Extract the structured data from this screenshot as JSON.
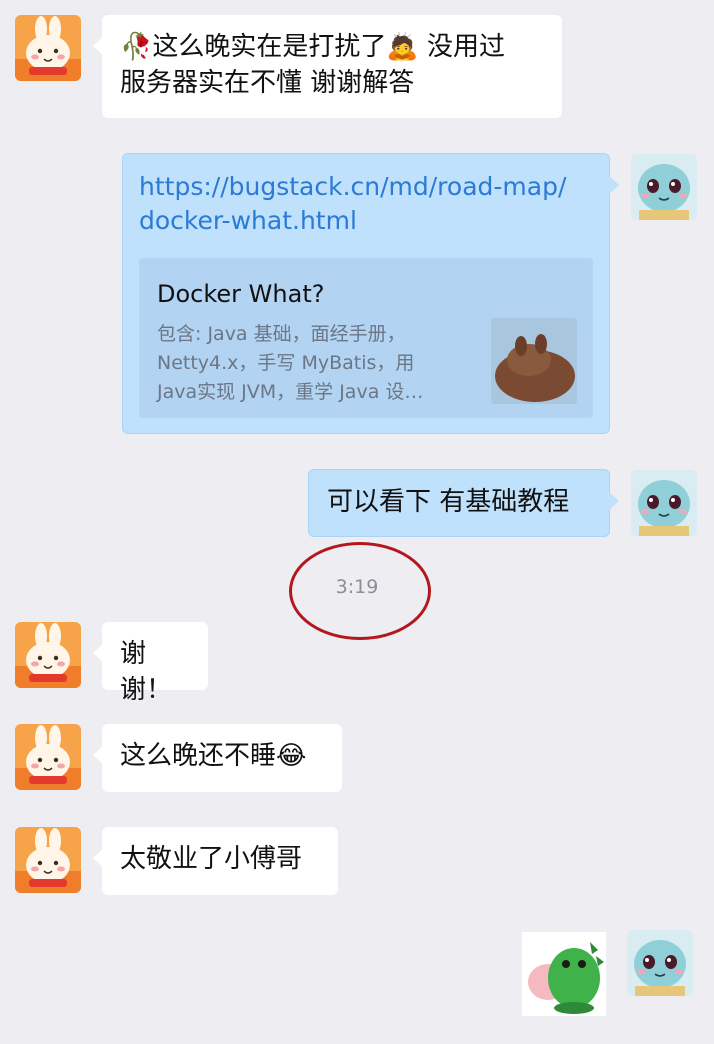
{
  "messages": {
    "m1": {
      "line1": "🥀这么晚实在是打扰了🙇 没用过",
      "line2": "服务器实在不懂 谢谢解答"
    },
    "m2": {
      "link_line1": "https://bugstack.cn/md/road-map/",
      "link_line2": "docker-what.html",
      "card_title": "Docker What?",
      "card_desc_line1": "包含: Java 基础，面经手册，",
      "card_desc_line2": "Netty4.x，手写 MyBatis，用",
      "card_desc_line3": "Java实现 JVM，重学 Java 设…"
    },
    "m3": {
      "text": "可以看下 有基础教程"
    },
    "timestamp": "3:19",
    "m4": {
      "text": "谢谢！"
    },
    "m5": {
      "text": "这么晚还不睡😂"
    },
    "m6": {
      "text": "太敬业了小傅哥"
    }
  },
  "icons": {
    "rabbit_avatar": "rabbit-avatar",
    "squirtle_avatar": "squirtle-avatar",
    "dinosaur_sticker": "green-dinosaur-sticker"
  },
  "colors": {
    "background": "#ededf2",
    "sent_bubble": "#bfe1fb",
    "link": "#2b7ad6",
    "annotation_circle": "#b3181e"
  }
}
